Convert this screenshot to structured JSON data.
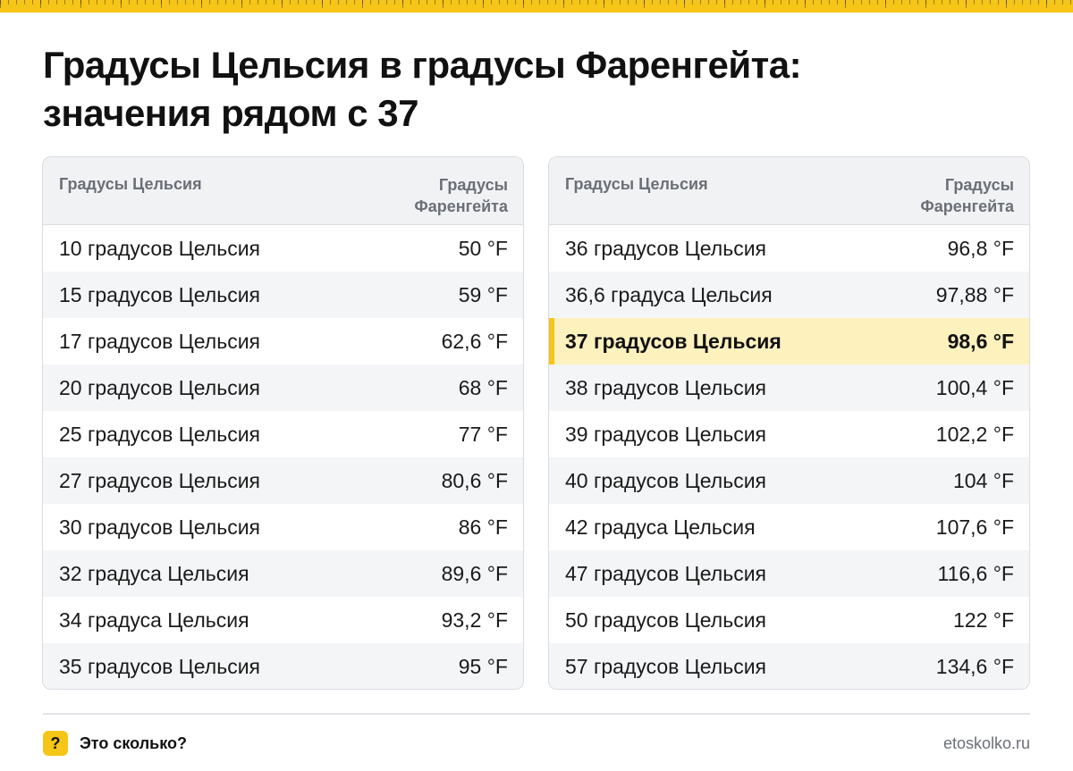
{
  "page": {
    "title_line1": "Градусы Цельсия в градусы Фаренгейта:",
    "title_line2": "значения рядом с 37"
  },
  "table_headers": {
    "celsius": "Градусы Цельсия",
    "fahrenheit_line1": "Градусы",
    "fahrenheit_line2": "Фаренгейта"
  },
  "left_table": [
    {
      "c": "10 градусов Цельсия",
      "f": "50 °F"
    },
    {
      "c": "15 градусов Цельсия",
      "f": "59 °F"
    },
    {
      "c": "17 градусов Цельсия",
      "f": "62,6 °F"
    },
    {
      "c": "20 градусов Цельсия",
      "f": "68 °F"
    },
    {
      "c": "25 градусов Цельсия",
      "f": "77 °F"
    },
    {
      "c": "27 градусов Цельсия",
      "f": "80,6 °F"
    },
    {
      "c": "30 градусов Цельсия",
      "f": "86 °F"
    },
    {
      "c": "32 градуса Цельсия",
      "f": "89,6 °F"
    },
    {
      "c": "34 градуса Цельсия",
      "f": "93,2 °F"
    },
    {
      "c": "35 градусов Цельсия",
      "f": "95 °F"
    }
  ],
  "right_table": [
    {
      "c": "36 градусов Цельсия",
      "f": "96,8 °F"
    },
    {
      "c": "36,6 градуса Цельсия",
      "f": "97,88 °F"
    },
    {
      "c": "37 градусов Цельсия",
      "f": "98,6 °F",
      "highlighted": true
    },
    {
      "c": "38 градусов Цельсия",
      "f": "100,4 °F"
    },
    {
      "c": "39 градусов Цельсия",
      "f": "102,2 °F"
    },
    {
      "c": "40 градусов Цельсия",
      "f": "104 °F"
    },
    {
      "c": "42 градуса Цельсия",
      "f": "107,6 °F"
    },
    {
      "c": "47 градусов Цельсия",
      "f": "116,6 °F"
    },
    {
      "c": "50 градусов Цельсия",
      "f": "122 °F"
    },
    {
      "c": "57 градусов Цельсия",
      "f": "134,6 °F"
    }
  ],
  "footer": {
    "badge_symbol": "?",
    "label": "Это сколько?",
    "site": "etoskolko.ru"
  },
  "colors": {
    "accent": "#f5c518",
    "highlight_row": "#fdf1bd",
    "zebra_row": "#f4f5f7",
    "header_bg": "#f1f2f4",
    "muted_text": "#6b6f77"
  }
}
